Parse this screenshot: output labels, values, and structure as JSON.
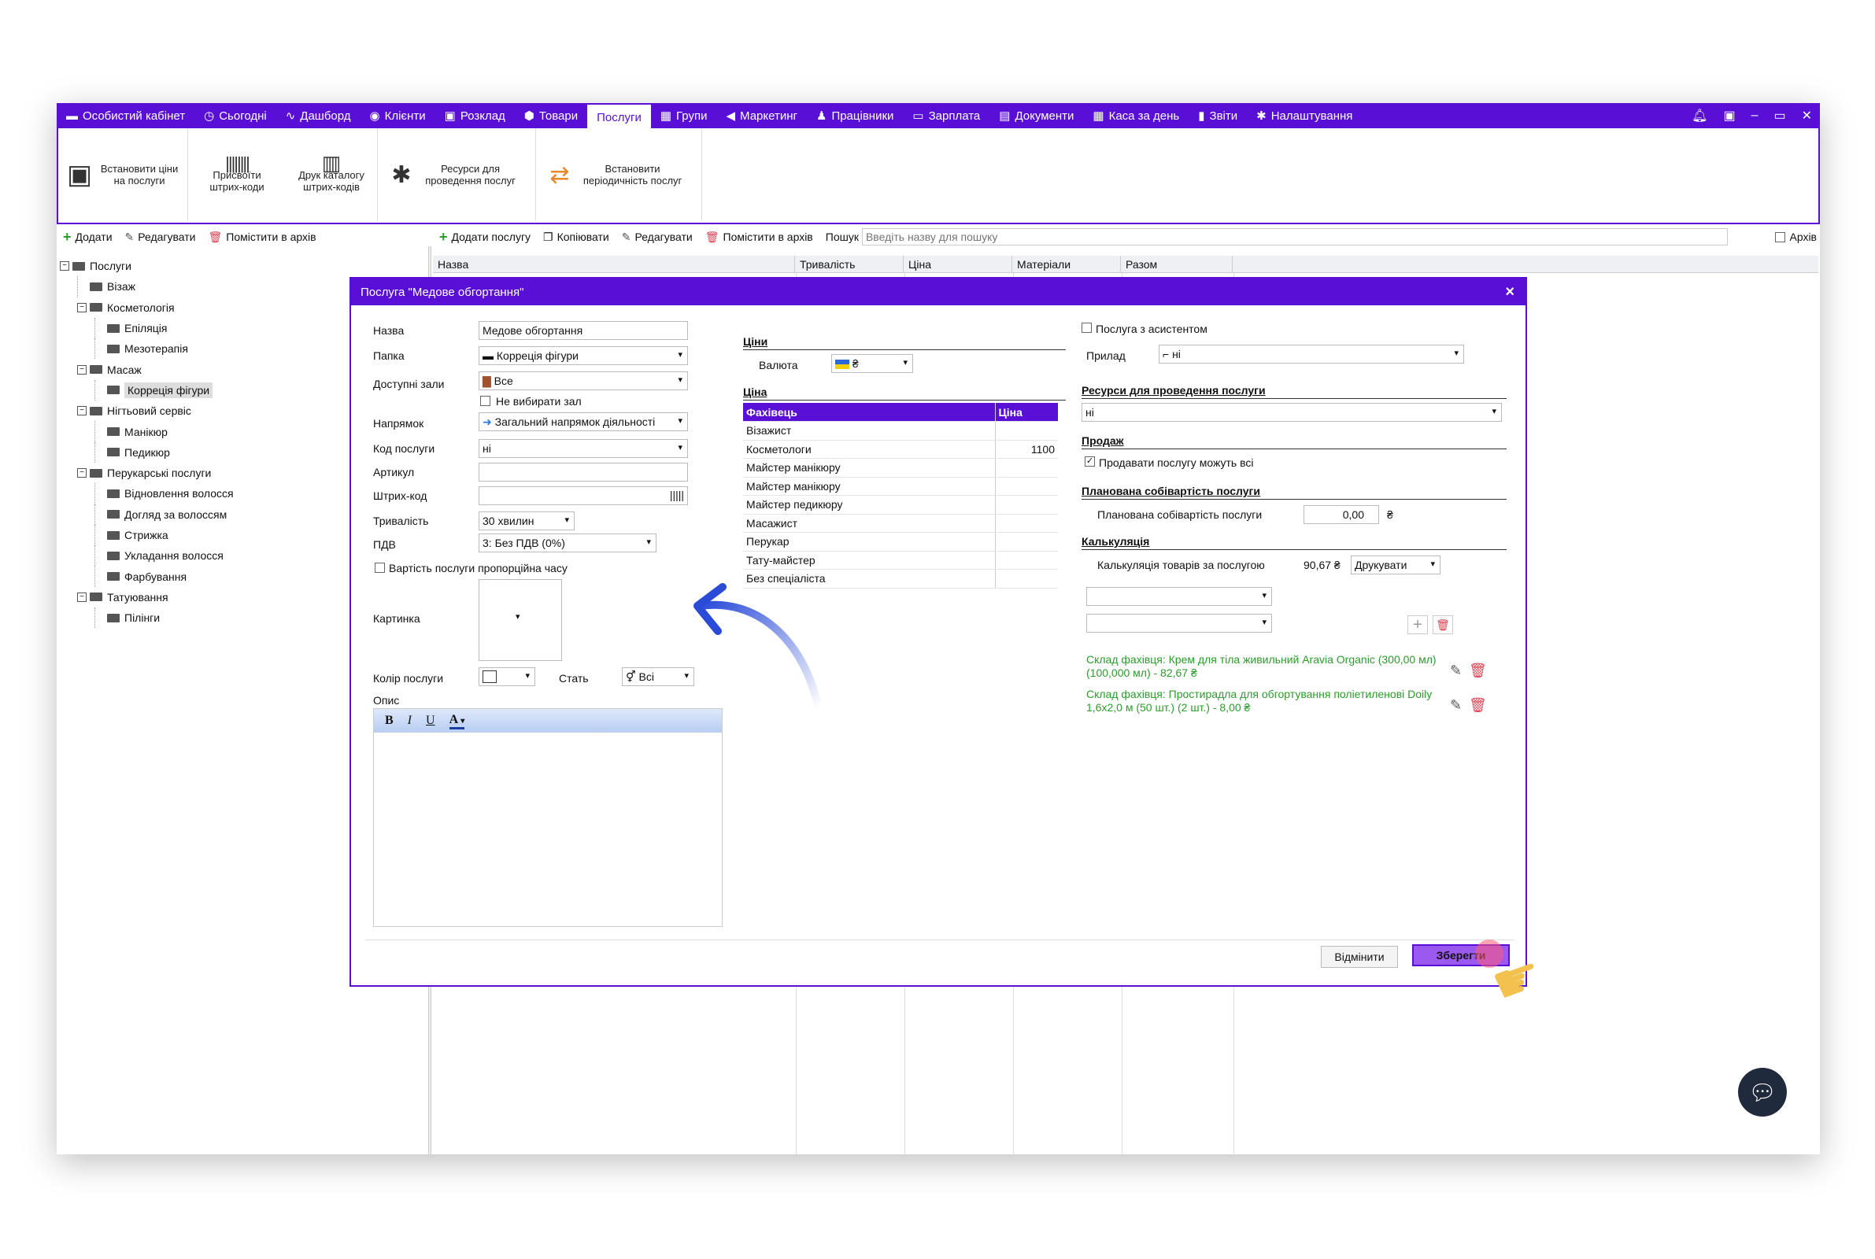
{
  "menu": {
    "items": [
      {
        "label": "Особистий кабінет",
        "icon": "briefcase-icon",
        "glyph": "▬"
      },
      {
        "label": "Сьогодні",
        "icon": "clock-icon",
        "glyph": "◷"
      },
      {
        "label": "Дашборд",
        "icon": "pulse-icon",
        "glyph": "∿"
      },
      {
        "label": "Клієнти",
        "icon": "user-circle-icon",
        "glyph": "◉"
      },
      {
        "label": "Розклад",
        "icon": "calendar-icon",
        "glyph": "▣"
      },
      {
        "label": "Товари",
        "icon": "box-icon",
        "glyph": "⬢"
      },
      {
        "label": "Послуги",
        "icon": "",
        "glyph": ""
      },
      {
        "label": "Групи",
        "icon": "group-icon",
        "glyph": "▦"
      },
      {
        "label": "Маркетинг",
        "icon": "megaphone-icon",
        "glyph": "◀"
      },
      {
        "label": "Працівники",
        "icon": "person-icon",
        "glyph": "♟"
      },
      {
        "label": "Зарплата",
        "icon": "money-icon",
        "glyph": "▭"
      },
      {
        "label": "Документи",
        "icon": "document-icon",
        "glyph": "▤"
      },
      {
        "label": "Каса за день",
        "icon": "calculator-icon",
        "glyph": "▦"
      },
      {
        "label": "Звіти",
        "icon": "bar-chart-icon",
        "glyph": "▮"
      },
      {
        "label": "Налаштування",
        "icon": "gear-icon",
        "glyph": "✱"
      }
    ],
    "active": "Послуги"
  },
  "ribbon": {
    "set_prices": "Встановити ціни на послуги",
    "assign_barcodes": "Присвоїти штрих-коди",
    "print_catalog": "Друк каталогу штрих-кодів",
    "resources": "Ресурси для проведення послуг",
    "periodicity": "Встановити періодичність послуг"
  },
  "left_toolbar": {
    "add": "Додати",
    "edit": "Редагувати",
    "archive": "Помістити в архів"
  },
  "right_toolbar": {
    "add_service": "Додати послугу",
    "copy": "Копіювати",
    "edit": "Редагувати",
    "archive": "Помістити в архів",
    "search_label": "Пошук",
    "search_placeholder": "Введіть назву для пошуку",
    "archive_checkbox": "Архів"
  },
  "tree": [
    {
      "label": "Послуги",
      "level": 0,
      "expand": true
    },
    {
      "label": "Візаж",
      "level": 1
    },
    {
      "label": "Косметологія",
      "level": 1,
      "expand": true
    },
    {
      "label": "Епіляція",
      "level": 2
    },
    {
      "label": "Мезотерапія",
      "level": 2
    },
    {
      "label": "Масаж",
      "level": 1,
      "expand": true
    },
    {
      "label": "Корреція фігури",
      "level": 2,
      "selected": true
    },
    {
      "label": "Нігтьовий сервіс",
      "level": 1,
      "expand": true
    },
    {
      "label": "Манікюр",
      "level": 2
    },
    {
      "label": "Педикюр",
      "level": 2
    },
    {
      "label": "Перукарські послуги",
      "level": 1,
      "expand": true
    },
    {
      "label": "Відновлення волосся",
      "level": 2
    },
    {
      "label": "Догляд за волоссям",
      "level": 2
    },
    {
      "label": "Стрижка",
      "level": 2
    },
    {
      "label": "Укладання волосся",
      "level": 2
    },
    {
      "label": "Фарбування",
      "level": 2
    },
    {
      "label": "Татуювання",
      "level": 1,
      "expand": true
    },
    {
      "label": "Пілінги",
      "level": 2
    }
  ],
  "grid": {
    "columns": [
      "Назва",
      "Тривалість",
      "Ціна",
      "Матеріали",
      "Разом"
    ]
  },
  "dialog": {
    "title": "Послуга \"Медове обгортання\"",
    "close": "×",
    "fields": {
      "name_label": "Назва",
      "name_value": "Медове обгортання",
      "folder_label": "Папка",
      "folder_value": "Корреція фігури",
      "halls_label": "Доступні зали",
      "halls_value": "Все",
      "no_hall": "Не вибирати зал",
      "direction_label": "Напрямок",
      "direction_value": "Загальний напрямок діяльності",
      "code_label": "Код послуги",
      "code_value": "ні",
      "article_label": "Артикул",
      "barcode_label": "Штрих-код",
      "duration_label": "Тривалість",
      "duration_value": "30 хвилин",
      "vat_label": "ПДВ",
      "vat_value": "3: Без ПДВ (0%)",
      "proportional": "Вартість послуги пропорційна часу",
      "image_label": "Картинка",
      "color_label": "Колір послуги",
      "gender_label": "Стать",
      "gender_value": "Всі",
      "desc_label": "Опис",
      "editor_bold": "B",
      "editor_italic": "I",
      "editor_underline": "U",
      "editor_font_color": "A"
    },
    "prices": {
      "section": "Ціни",
      "currency_label": "Валюта",
      "currency_value": "₴",
      "price_section": "Ціна",
      "col_specialist": "Фахівець",
      "col_price": "Ціна",
      "rows": [
        {
          "name": "Візажист",
          "price": ""
        },
        {
          "name": "Косметологи",
          "price": "1100"
        },
        {
          "name": "Майстер манікюру",
          "price": ""
        },
        {
          "name": "Майстер манікюру",
          "price": ""
        },
        {
          "name": "Майстер педикюру",
          "price": ""
        },
        {
          "name": "Масажист",
          "price": ""
        },
        {
          "name": "Перукар",
          "price": ""
        },
        {
          "name": "Тату-майстер",
          "price": ""
        },
        {
          "name": "Без спеціаліста",
          "price": ""
        }
      ]
    },
    "right": {
      "assistant": "Послуга з асистентом",
      "device_label": "Прилад",
      "device_value": "ні",
      "resources_section": "Ресурси для проведення послуги",
      "resources_value": "ні",
      "sale_section": "Продаж",
      "sell_all": "Продавати послугу можуть всі",
      "cost_section": "Планована собівартість послуги",
      "cost_label": "Планована собівартість послуги",
      "cost_value": "0,00",
      "cost_currency": "₴",
      "calc_section": "Калькуляція",
      "calc_label": "Калькуляція товарів за послугою",
      "calc_value": "90,67 ₴",
      "print_button": "Друкувати",
      "warehouse1": "Склад фахівця: Крем для тіла живильний Aravia Organic (300,00 мл) (100,000 мл) - 82,67 ₴",
      "warehouse2": "Склад фахівця: Простирадла для обгортування поліетиленові Doily 1,6x2,0 м (50 шт.) (2 шт.) - 8,00 ₴"
    },
    "cancel": "Відмінити",
    "save": "Зберегти"
  },
  "colors": {
    "accent": "#5a0fd6",
    "green": "#2a9d2a",
    "save_bg": "#9b59f0"
  }
}
